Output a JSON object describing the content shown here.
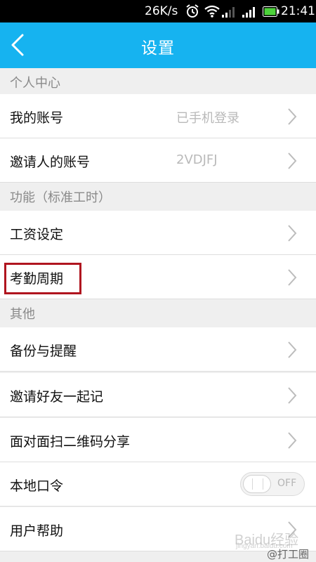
{
  "status_bar": {
    "net_speed": "26K/s",
    "time": "21:41",
    "icons": [
      "alarm-icon",
      "wifi-icon",
      "signal-icon",
      "signal-icon",
      "battery-icon"
    ]
  },
  "header": {
    "title": "设置",
    "back_icon": "chevron-left-icon"
  },
  "sections": {
    "personal": {
      "title": "个人中心",
      "items": [
        {
          "label": "我的账号",
          "value": "已手机登录"
        },
        {
          "label": "邀请人的账号",
          "value": "2VDJFJ"
        }
      ]
    },
    "function": {
      "title": "功能（标准工时）",
      "items": [
        {
          "label": "工资设定"
        },
        {
          "label": "考勤周期"
        }
      ]
    },
    "other": {
      "title": "其他",
      "items": [
        {
          "label": "备份与提醒"
        },
        {
          "label": "邀请好友一起记"
        },
        {
          "label": "面对面扫二维码分享"
        },
        {
          "label": "本地口令",
          "toggle": "OFF"
        },
        {
          "label": "用户帮助"
        }
      ]
    }
  },
  "watermark": {
    "text": "Baidu经验",
    "sub": "jingyan.baidu.com"
  },
  "credit": "@打工圈",
  "colors": {
    "header_bg": "#16b3f0",
    "highlight": "#b0151f",
    "section_bg": "#efefef"
  }
}
